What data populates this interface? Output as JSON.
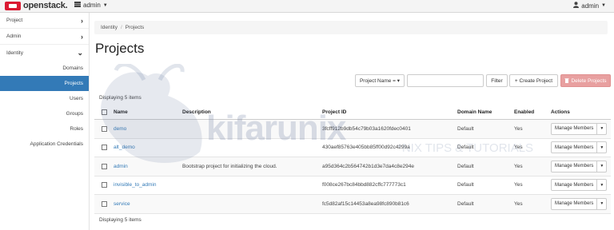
{
  "topbar": {
    "brand": "openstack.",
    "project_switcher": "admin",
    "user": "admin"
  },
  "sidebar": {
    "sections": [
      {
        "label": "Project",
        "chevron": "›"
      },
      {
        "label": "Admin",
        "chevron": "›"
      },
      {
        "label": "Identity",
        "chevron": "⌄"
      }
    ],
    "items": [
      {
        "label": "Domains"
      },
      {
        "label": "Projects"
      },
      {
        "label": "Users"
      },
      {
        "label": "Groups"
      },
      {
        "label": "Roles"
      },
      {
        "label": "Application Credentials"
      }
    ]
  },
  "breadcrumb": [
    "Identity",
    "/",
    "Projects"
  ],
  "page_title": "Projects",
  "toolbar": {
    "filter_select": "Project Name = ▾",
    "filter_button": "Filter",
    "create_button": "+ Create Project",
    "delete_button": "Delete Projects"
  },
  "displaying_top": "Displaying 5 items",
  "displaying_bottom": "Displaying 5 items",
  "table": {
    "headers": [
      "Name",
      "Description",
      "Project ID",
      "Domain Name",
      "Enabled",
      "Actions"
    ],
    "rows": [
      {
        "name": "demo",
        "description": "",
        "project_id": "3fcff912b9db54c79b03a1620fdec0401",
        "domain": "Default",
        "enabled": "Yes",
        "action": "Manage Members"
      },
      {
        "name": "alt_demo",
        "description": "",
        "project_id": "430aef85763e405bb85ff00d92c4299a",
        "domain": "Default",
        "enabled": "Yes",
        "action": "Manage Members"
      },
      {
        "name": "admin",
        "description": "Bootstrap project for initializing the cloud.",
        "project_id": "a95d364c2b564742b1d3e7da4c8e294e",
        "domain": "Default",
        "enabled": "Yes",
        "action": "Manage Members"
      },
      {
        "name": "invisible_to_admin",
        "description": "",
        "project_id": "f008ce267bc84bbd882cffc777773c1",
        "domain": "Default",
        "enabled": "Yes",
        "action": "Manage Members"
      },
      {
        "name": "service",
        "description": "",
        "project_id": "fc5d82af15c14453a8ea98fc890b81c6",
        "domain": "Default",
        "enabled": "Yes",
        "action": "Manage Members"
      }
    ]
  },
  "watermark": {
    "word": "kifarunix",
    "tagline": "*NIX TIPS & TUTORIALS"
  },
  "colors": {
    "active_nav": "#337ab7",
    "brand_red": "#da1a32",
    "delete_btn": "#e8a0a0",
    "link": "#337ab7"
  }
}
